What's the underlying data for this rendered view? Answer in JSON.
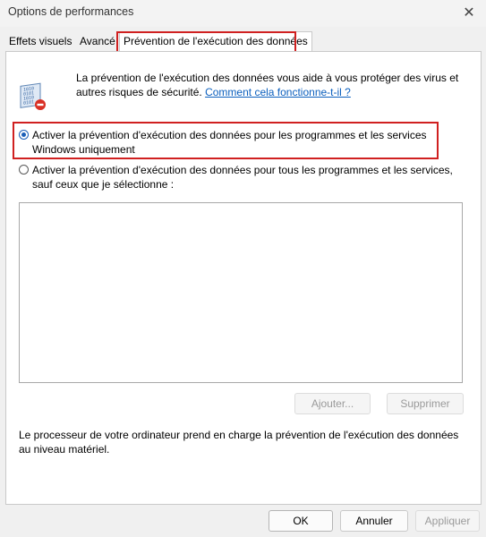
{
  "window": {
    "title": "Options de performances",
    "close_glyph": "✕"
  },
  "tabs": [
    {
      "label": "Effets visuels",
      "selected": false
    },
    {
      "label": "Avancé",
      "selected": false
    },
    {
      "label": "Prévention de l'exécution des données",
      "selected": true
    }
  ],
  "dep": {
    "description": "La prévention de l'exécution des données vous aide à vous protéger des virus et autres risques de sécurité.",
    "help_link": "Comment cela fonctionne-t-il ?",
    "icon": "dep-shield-icon"
  },
  "options": {
    "essential": {
      "label": "Activer la prévention d'exécution des données pour les programmes et les services Windows uniquement",
      "checked": true
    },
    "all": {
      "label": "Activer la prévention d'exécution des données pour tous les programmes et les services, sauf ceux que je sélectionne :",
      "checked": false
    }
  },
  "exceptions_list": [],
  "list_buttons": {
    "add": "Ajouter...",
    "remove": "Supprimer"
  },
  "hardware_note": "Le processeur de votre ordinateur prend en charge la prévention de l'exécution des données au niveau matériel.",
  "footer": {
    "ok": "OK",
    "cancel": "Annuler",
    "apply": "Appliquer"
  },
  "colors": {
    "highlight_border": "#d02020",
    "link": "#0b5fbe",
    "radio_selected": "#1b5fb8"
  }
}
